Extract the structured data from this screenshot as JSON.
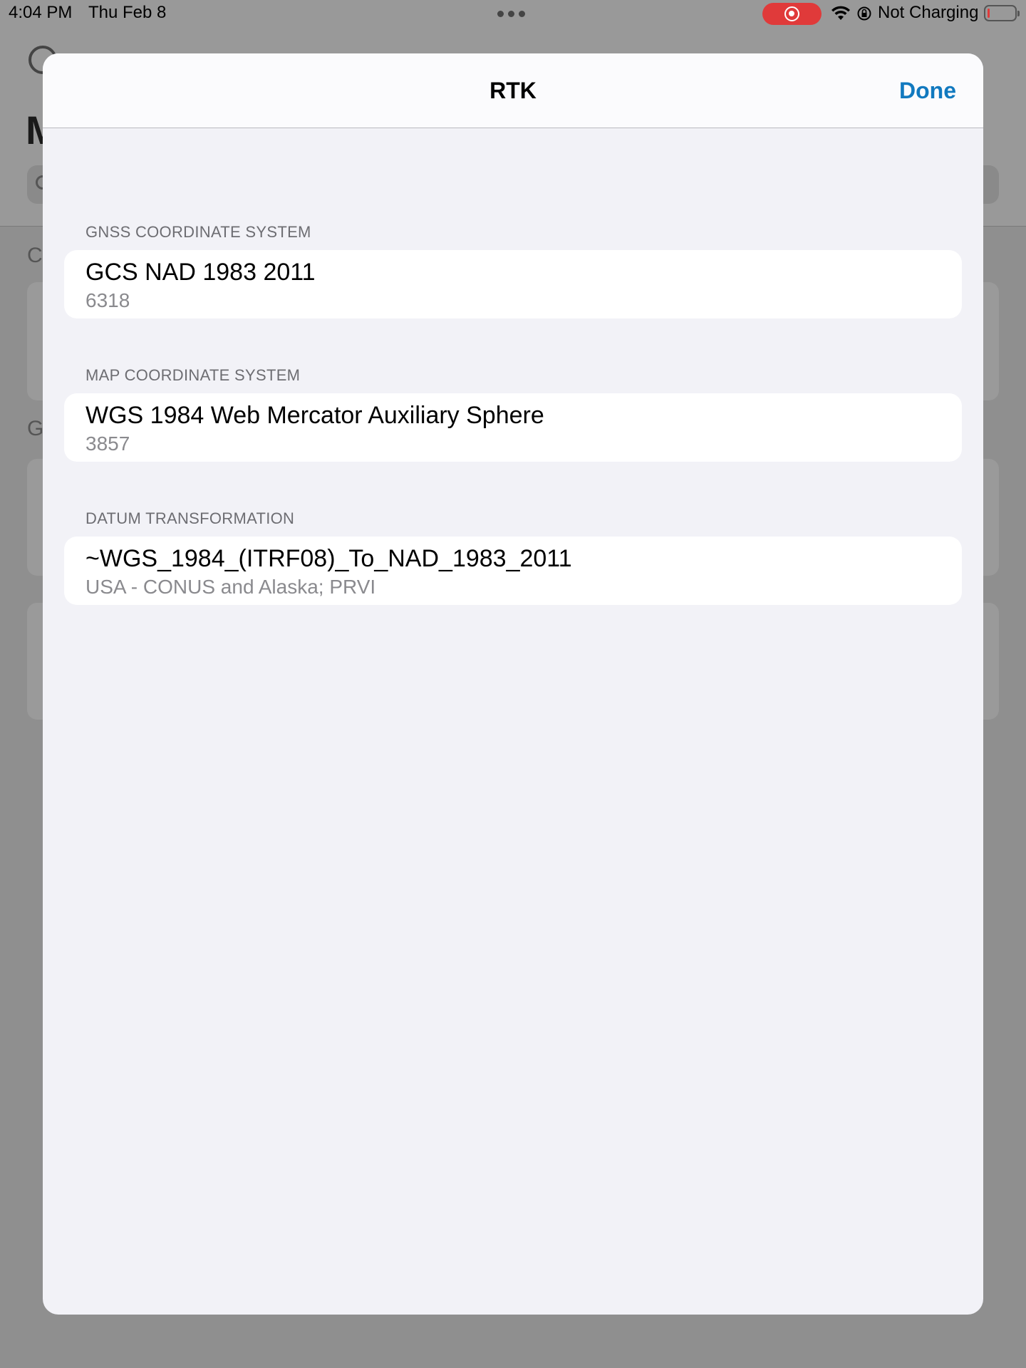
{
  "status_bar": {
    "time": "4:04 PM",
    "date": "Thu Feb 8",
    "charging_status": "Not Charging",
    "battery_level": 0.08,
    "recording_color": "#e03a3a"
  },
  "background_app": {
    "title_fragment": "M",
    "section_fragment_1": "C",
    "section_fragment_2": "G",
    "chevron": "›"
  },
  "sheet": {
    "title": "RTK",
    "done_label": "Done",
    "accent_color": "#1179bf",
    "sections": [
      {
        "header": "GNSS COORDINATE SYSTEM",
        "title": "GCS NAD 1983 2011",
        "subtitle": "6318"
      },
      {
        "header": "MAP COORDINATE SYSTEM",
        "title": "WGS 1984 Web Mercator Auxiliary Sphere",
        "subtitle": "3857"
      },
      {
        "header": "DATUM TRANSFORMATION",
        "title": "~WGS_1984_(ITRF08)_To_NAD_1983_2011",
        "subtitle": "USA - CONUS and Alaska; PRVI"
      }
    ]
  }
}
